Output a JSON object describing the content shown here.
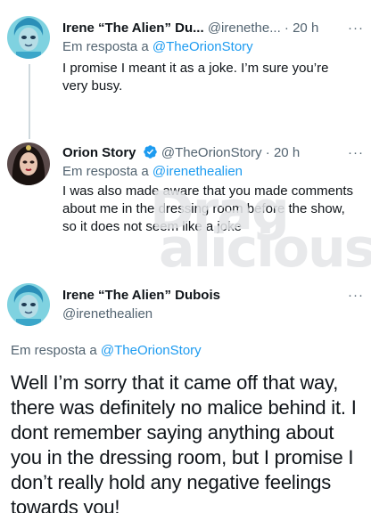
{
  "tweets": [
    {
      "name": "Irene “The Alien” Du...",
      "handle": "@irenethe...",
      "dot": "·",
      "time": "20 h",
      "more": "···",
      "reply_prefix": "Em resposta a ",
      "reply_handle": "@TheOrionStory",
      "text": "I promise I meant it as a joke. I’m sure you’re very busy."
    },
    {
      "name": "Orion Story",
      "verified": true,
      "handle": "@TheOrionStory",
      "dot": "·",
      "time": "20 h",
      "more": "···",
      "reply_prefix": "Em resposta a ",
      "reply_handle": "@irenethealien",
      "text": "I was also made aware that you made comments about me in the dressing room before the show, so it does not seem like a joke"
    }
  ],
  "main_tweet": {
    "name": "Irene “The Alien” Dubois",
    "handle": "@irenethealien",
    "more": "···",
    "reply_prefix": "Em resposta a ",
    "reply_handle": "@TheOrionStory",
    "text": "Well I’m sorry that it came off that way, there was definitely no malice behind it. I dont remember saying anything about you in the dressing room, but I promise I don’t really hold any negative feelings towards you!"
  },
  "watermark": {
    "line1": "Drag",
    "line2": "alicious"
  },
  "colors": {
    "link": "#1d9bf0",
    "muted": "#536471",
    "text": "#0f1419",
    "verified": "#1d9bf0"
  }
}
